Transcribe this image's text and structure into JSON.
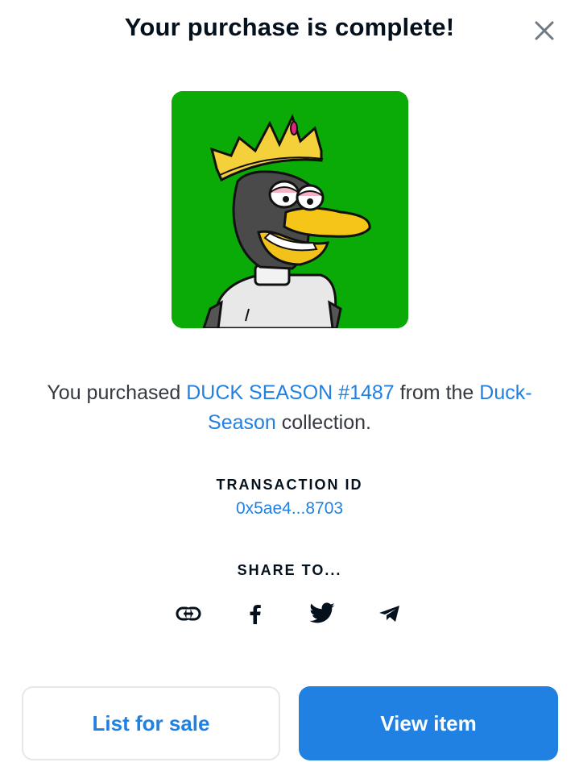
{
  "modal": {
    "title": "Your purchase is complete!",
    "close_icon": "close-icon"
  },
  "nft": {
    "image_icon": "duck-nft-image",
    "background_color": "#0aab07"
  },
  "purchase": {
    "prefix": "You purchased ",
    "item_name": "DUCK SEASON #1487",
    "middle": " from the ",
    "collection_name": "Duck-Season",
    "suffix": " collection."
  },
  "transaction": {
    "label": "TRANSACTION ID",
    "id": "0x5ae4...8703"
  },
  "share": {
    "label": "SHARE TO...",
    "items": [
      {
        "icon": "link-icon"
      },
      {
        "icon": "facebook-icon"
      },
      {
        "icon": "twitter-icon"
      },
      {
        "icon": "telegram-icon"
      }
    ]
  },
  "actions": {
    "list_for_sale": "List for sale",
    "view_item": "View item"
  },
  "colors": {
    "accent": "#2081e2",
    "text_dark": "#04111d",
    "text_body": "#353840",
    "border": "#e5e8eb"
  }
}
